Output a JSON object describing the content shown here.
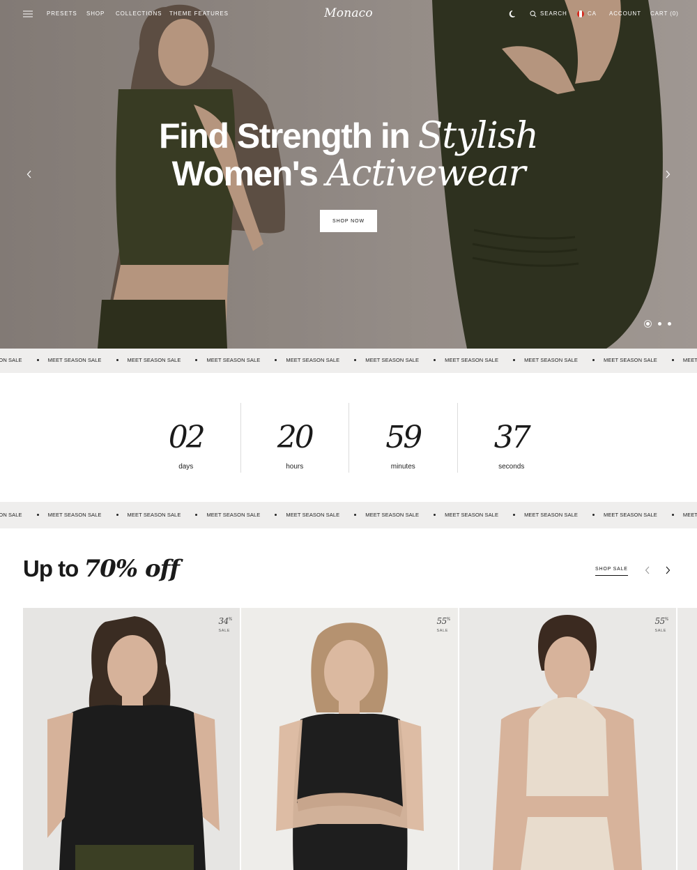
{
  "nav": {
    "links": [
      "PRESETS",
      "SHOP",
      "COLLECTIONS",
      "THEME FEATURES"
    ],
    "logo": "Monaco",
    "search": "SEARCH",
    "country": "CA",
    "account": "ACCOUNT",
    "cart": "CART (0)"
  },
  "hero": {
    "line1_plain": "Find Strength in",
    "line1_italic": "Stylish",
    "line2_plain": "Women's",
    "line2_italic": "Activewear",
    "cta": "SHOP NOW",
    "slide_count": 3,
    "active_slide": 1
  },
  "marquee": {
    "text": "MEET SEASON SALE",
    "first_partial": "SEASON SALE"
  },
  "countdown": {
    "cells": [
      {
        "value": "02",
        "label": "days"
      },
      {
        "value": "20",
        "label": "hours"
      },
      {
        "value": "59",
        "label": "minutes"
      },
      {
        "value": "37",
        "label": "seconds"
      }
    ]
  },
  "sale": {
    "title_plain": "Up to",
    "title_italic": "70% off",
    "shop_link": "SHOP SALE"
  },
  "products": [
    {
      "discount": "34",
      "unit": "%",
      "badge": "SALE"
    },
    {
      "discount": "55",
      "unit": "%",
      "badge": "SALE"
    },
    {
      "discount": "55",
      "unit": "%",
      "badge": "SALE"
    }
  ],
  "colors": {
    "accent_olive": "#3b3f24",
    "marquee_bg": "#efeeed",
    "text": "#1a1a1a"
  }
}
